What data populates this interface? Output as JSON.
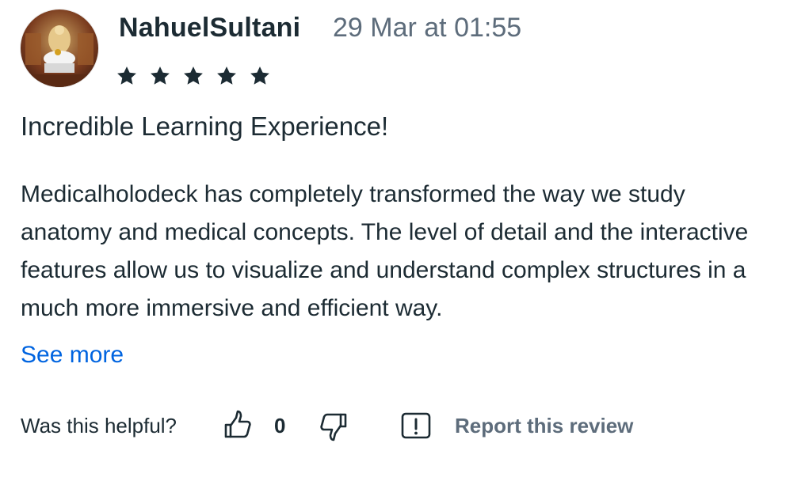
{
  "review": {
    "username": "NahuelSultani",
    "timestamp": "29 Mar at 01:55",
    "rating": 5,
    "rating_max": 5,
    "title": "Incredible Learning Experience!",
    "body": "Medicalholodeck has completely transformed the way we study anatomy and medical concepts. The level of detail and the interactive features allow us to visualize and understand complex structures in a much more immersive and efficient way.",
    "see_more_label": "See more"
  },
  "feedback": {
    "helpful_question": "Was this helpful?",
    "helpful_count": "0",
    "report_label": "Report this review"
  },
  "icons": {
    "avatar": "avatar-image",
    "star": "star-icon",
    "thumbs_up": "thumbs-up-icon",
    "thumbs_down": "thumbs-down-icon",
    "report": "report-icon"
  },
  "colors": {
    "text_primary": "#1c2b33",
    "text_secondary": "#5d6c7b",
    "link": "#0064e0"
  }
}
